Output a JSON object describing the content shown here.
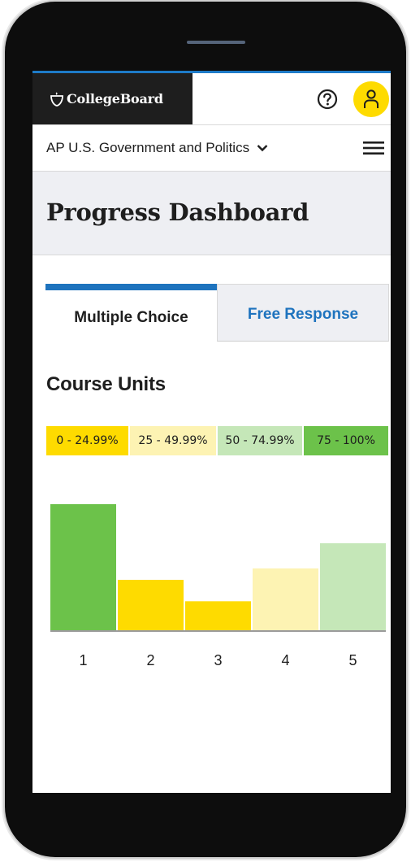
{
  "app": {
    "brand_name": "CollegeBoard"
  },
  "header": {
    "help_icon": "help-circle-icon",
    "account_icon": "user-icon"
  },
  "course_nav": {
    "selected_course": "AP U.S. Government and Politics",
    "dropdown_icon": "chevron-down-icon",
    "menu_icon": "hamburger-menu-icon"
  },
  "page": {
    "title": "Progress Dashboard"
  },
  "tabs": [
    {
      "label": "Multiple Choice",
      "active": true
    },
    {
      "label": "Free Response",
      "active": false
    }
  ],
  "section": {
    "title": "Course Units"
  },
  "legend": [
    {
      "label": "0 - 24.99%",
      "color": "#fedb00"
    },
    {
      "label": "25 - 49.99%",
      "color": "#fdf3b3"
    },
    {
      "label": "50 - 74.99%",
      "color": "#c5e7b8"
    },
    {
      "label": "75 - 100%",
      "color": "#6cc24a"
    }
  ],
  "colors": {
    "accent_blue": "#1e73be",
    "brand_bar": "#1e1e1e",
    "account_yellow": "#fedb00"
  },
  "chart_data": {
    "type": "bar",
    "categories": [
      "1",
      "2",
      "3",
      "4",
      "5"
    ],
    "values": [
      100,
      40,
      23,
      49,
      69
    ],
    "colors": [
      "#6cc24a",
      "#fedb00",
      "#fedb00",
      "#fdf3b3",
      "#c5e7b8"
    ],
    "ylim": [
      0,
      100
    ],
    "grid": false
  }
}
